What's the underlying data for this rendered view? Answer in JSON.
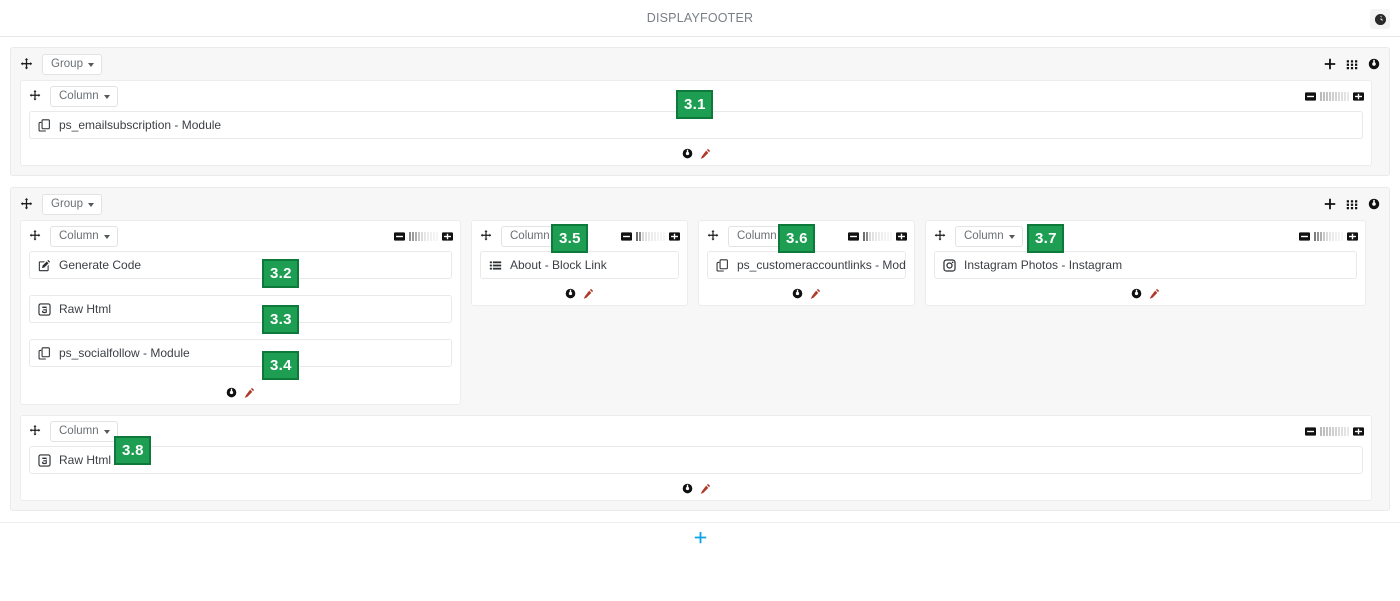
{
  "header": {
    "title": "DISPLAYFOOTER",
    "settings_icon": "gear-icon"
  },
  "labels": {
    "group": "Group",
    "column": "Column",
    "move": "move-icon",
    "add": "plus-icon",
    "grid": "grid-icon",
    "gear": "gear-icon",
    "pencil": "pencil-icon",
    "minus": "minus-square-icon",
    "plus_square": "plus-square-icon",
    "width_bars": "column-width-icon"
  },
  "groups": [
    {
      "label": "Group",
      "columns": [
        {
          "label": "Column",
          "width_fraction": 1.0,
          "rows": [
            {
              "icon": "copy-icon",
              "text": "ps_emailsubscription - Module",
              "badge": "3.1"
            }
          ]
        }
      ]
    },
    {
      "label": "Group",
      "columns": [
        {
          "label": "Column",
          "width_fraction": 0.5,
          "rows": [
            {
              "icon": "pencil-square-icon",
              "text": "Generate Code",
              "badge": "3.2"
            },
            {
              "icon": "html5-icon",
              "text": "Raw Html",
              "badge": "3.3"
            },
            {
              "icon": "copy-icon",
              "text": "ps_socialfollow - Module",
              "badge": "3.4"
            }
          ]
        },
        {
          "label": "Column",
          "width_fraction": 0.18,
          "head_badge": "3.5",
          "rows": [
            {
              "icon": "list-icon",
              "text": "About - Block Link"
            }
          ]
        },
        {
          "label": "Column",
          "width_fraction": 0.18,
          "head_badge": "3.6",
          "rows": [
            {
              "icon": "copy-icon",
              "text": "ps_customeraccountlinks - Module"
            }
          ]
        },
        {
          "label": "Column",
          "width_fraction": 0.4,
          "head_badge": "3.7",
          "rows": [
            {
              "icon": "instagram-icon",
              "text": "Instagram Photos - Instagram"
            }
          ]
        },
        {
          "label": "Column",
          "width_fraction": 1.0,
          "rows": [
            {
              "icon": "html5-icon",
              "text": "Raw Html",
              "badge": "3.8"
            }
          ]
        }
      ]
    }
  ],
  "bottom": {
    "add_icon": "plus-icon",
    "accent": "#0aa3e8"
  },
  "colors": {
    "badge_bg": "#1e9e52",
    "badge_border": "#0d7a3b",
    "pencil": "#b03a2a",
    "group_bg": "#f7f7f7",
    "panel_bg": "#ffffff",
    "title": "#7a7f86"
  }
}
